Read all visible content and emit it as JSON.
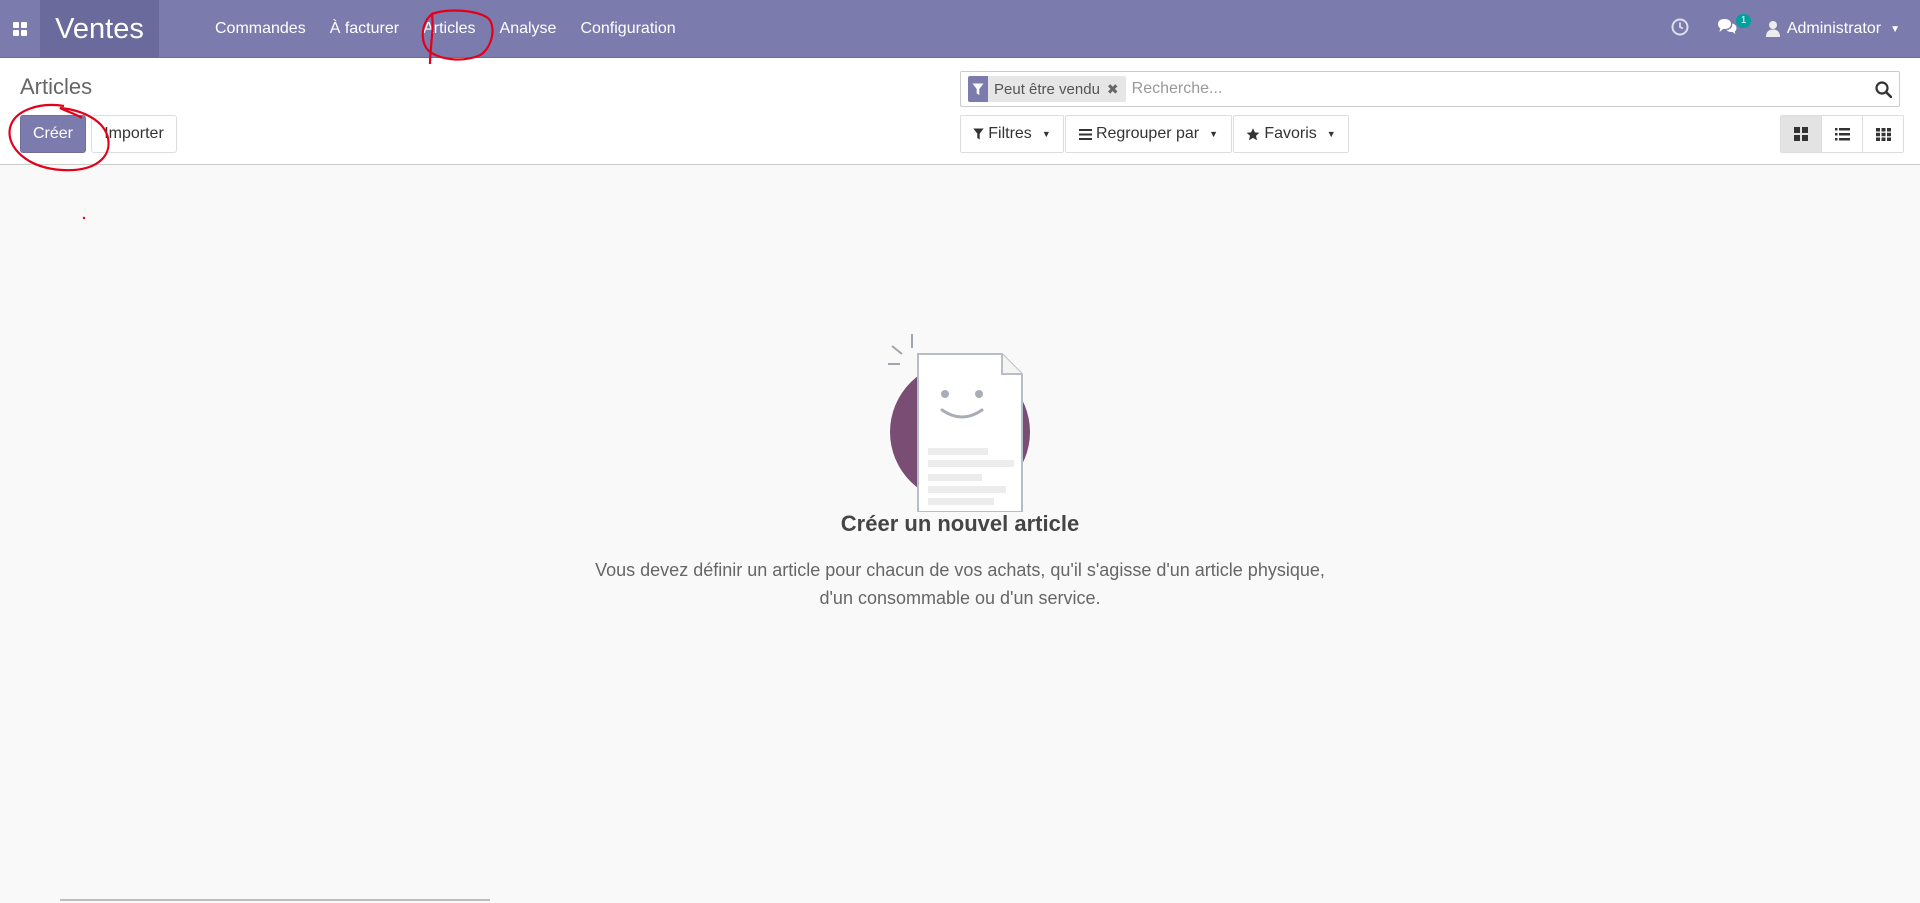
{
  "navbar": {
    "brand": "Ventes",
    "menu": [
      "Commandes",
      "À facturer",
      "Articles",
      "Analyse",
      "Configuration"
    ],
    "messages_badge": "1",
    "user": "Administrator",
    "icons": [
      "apps-icon",
      "clock-icon",
      "chat-icon",
      "user-icon"
    ]
  },
  "control_panel": {
    "title": "Articles",
    "create_label": "Créer",
    "import_label": "Importer",
    "search": {
      "facet_label": "Peut être vendu",
      "facet_remove": "✖",
      "placeholder": "Recherche..."
    },
    "filters_label": "Filtres",
    "groupby_label": "Regrouper par",
    "favorites_label": "Favoris",
    "views": [
      "kanban",
      "list",
      "pivot"
    ],
    "active_view": "kanban"
  },
  "empty_state": {
    "title": "Créer un nouvel article",
    "line1": "Vous devez définir un article pour chacun de vos achats, qu'il s'agisse d'un article physique,",
    "line2": "d'un consommable ou d'un service."
  },
  "colors": {
    "primary": "#7c7bad",
    "brand_bg": "#6a6a9c",
    "badge": "#00a09d",
    "annotation": "#e3001b"
  }
}
